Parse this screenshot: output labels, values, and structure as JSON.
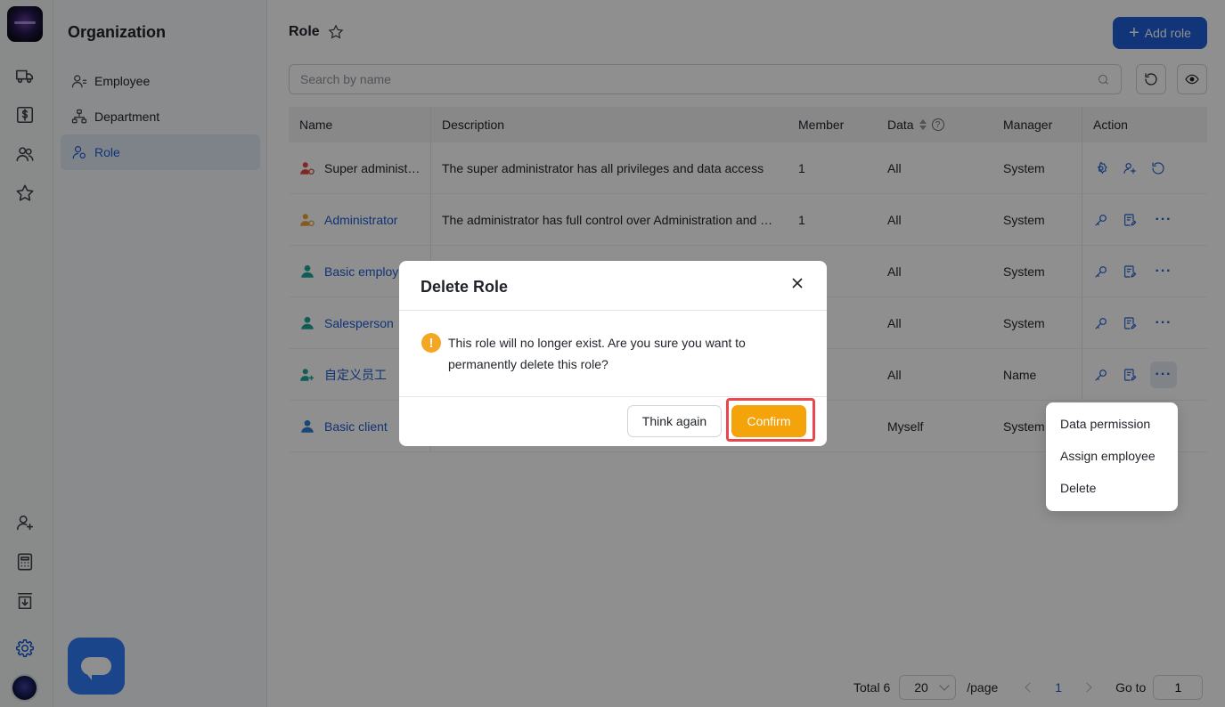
{
  "sidebar": {
    "title": "Organization",
    "items": [
      {
        "label": "Employee",
        "icon": "employee-icon"
      },
      {
        "label": "Department",
        "icon": "department-icon"
      },
      {
        "label": "Role",
        "icon": "role-icon",
        "active": true
      }
    ]
  },
  "header": {
    "title": "Role",
    "add_label": "Add role"
  },
  "search": {
    "placeholder": "Search by name",
    "value": ""
  },
  "table": {
    "columns": {
      "name": "Name",
      "description": "Description",
      "member": "Member",
      "data": "Data",
      "manager": "Manager",
      "action": "Action"
    },
    "rows": [
      {
        "name": "Super administrator",
        "description": "The super administrator has all privileges and data access",
        "member": "1",
        "data": "All",
        "manager": "System",
        "icon_color": "#e04848"
      },
      {
        "name": "Administrator",
        "description": "The administrator has full control over Administration and Settings",
        "member": "1",
        "data": "All",
        "manager": "System",
        "icon_color": "#e8a33a"
      },
      {
        "name": "Basic employee",
        "description": "",
        "member": "",
        "data": "All",
        "manager": "System",
        "icon_color": "#1ea79a"
      },
      {
        "name": "Salesperson",
        "description": "",
        "member": "",
        "data": "All",
        "manager": "System",
        "icon_color": "#1ea79a"
      },
      {
        "name": "自定义员工",
        "description": "",
        "member": "",
        "data": "All",
        "manager": "Name",
        "icon_color": "#1ea79a"
      },
      {
        "name": "Basic client",
        "description": "",
        "member": "",
        "data": "Myself",
        "manager": "System",
        "icon_color": "#2f7fd0"
      }
    ]
  },
  "dropdown": {
    "items": [
      "Data permission",
      "Assign employee",
      "Delete"
    ]
  },
  "pagination": {
    "total_label": "Total 6",
    "page_size": "20",
    "per_page_label": "/page",
    "current_page": "1",
    "goto_label": "Go to",
    "goto_value": "1"
  },
  "dialog": {
    "title": "Delete Role",
    "message": "This role will no longer exist. Are you sure you want to permanently delete this role?",
    "think_again": "Think again",
    "confirm": "Confirm"
  },
  "colors": {
    "primary": "#1f5fd6",
    "confirm": "#f5a30b",
    "warning": "#f5a623",
    "highlight_frame": "#e8474f"
  }
}
